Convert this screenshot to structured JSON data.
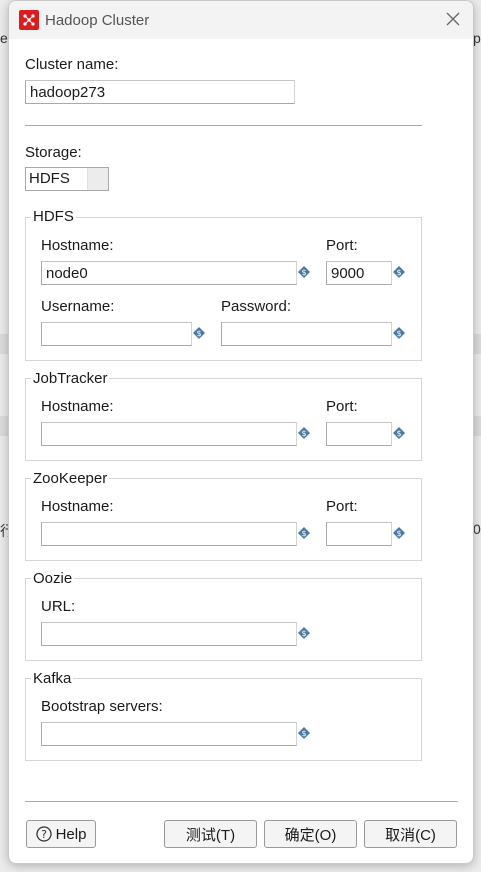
{
  "window": {
    "title": "Hadoop Cluster"
  },
  "background": {
    "left_top": "e",
    "right_top": "p",
    "left_mid": "行",
    "right_mid": "0"
  },
  "cluster": {
    "label": "Cluster name:",
    "value": "hadoop273"
  },
  "storage": {
    "label": "Storage:",
    "selected": "HDFS"
  },
  "hdfs": {
    "title": "HDFS",
    "hostname_label": "Hostname:",
    "hostname_value": "node0",
    "port_label": "Port:",
    "port_value": "9000",
    "username_label": "Username:",
    "username_value": "",
    "password_label": "Password:",
    "password_value": ""
  },
  "jobtracker": {
    "title": "JobTracker",
    "hostname_label": "Hostname:",
    "hostname_value": "",
    "port_label": "Port:",
    "port_value": ""
  },
  "zookeeper": {
    "title": "ZooKeeper",
    "hostname_label": "Hostname:",
    "hostname_value": "",
    "port_label": "Port:",
    "port_value": ""
  },
  "oozie": {
    "title": "Oozie",
    "url_label": "URL:",
    "url_value": ""
  },
  "kafka": {
    "title": "Kafka",
    "bootstrap_label": "Bootstrap servers:",
    "bootstrap_value": ""
  },
  "buttons": {
    "help": "Help",
    "test": "测试(T)",
    "ok": "确定(O)",
    "cancel": "取消(C)"
  },
  "icons": {
    "app": "hadoop-cluster-icon",
    "close": "close-icon",
    "variable": "variable-diamond-icon",
    "help": "question-circle-icon"
  },
  "colors": {
    "app_icon": "#d81e1e",
    "variable_icon": "#4a7aa6"
  }
}
